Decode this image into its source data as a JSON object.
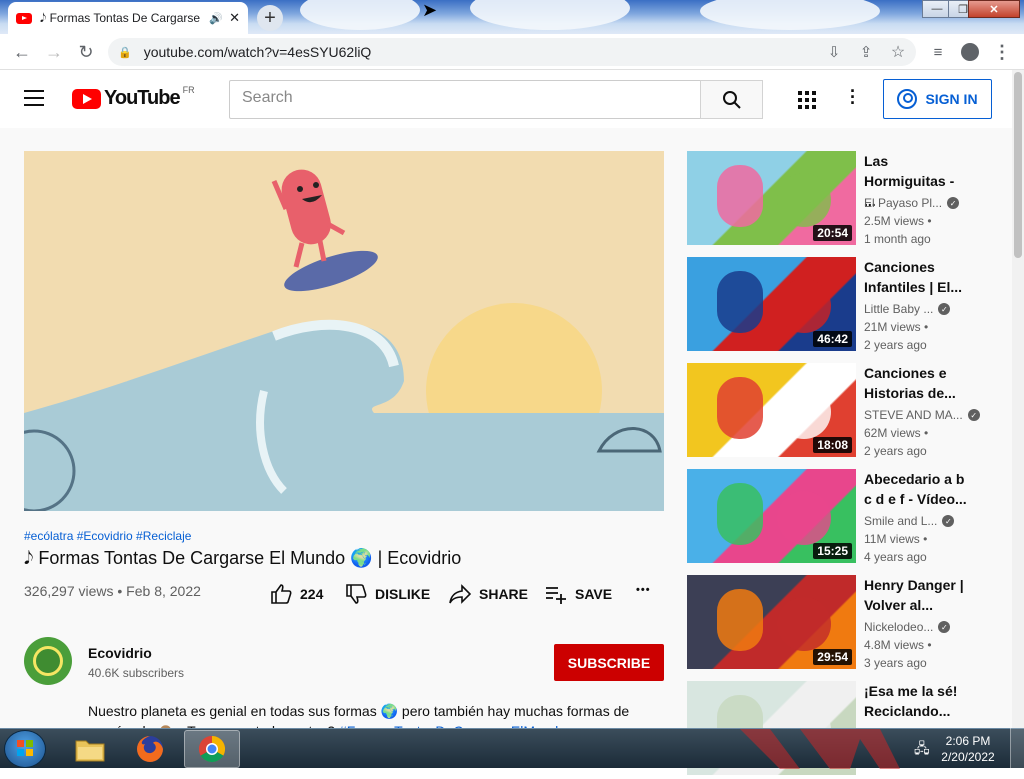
{
  "browser": {
    "tab_title": "𝅘𝅥𝅮 Formas Tontas De Cargarse El Mundo",
    "tab_close": "✕",
    "new_tab": "+",
    "url": "youtube.com/watch?v=4esSYU62liQ",
    "window_buttons": {
      "minimize": "—",
      "restore": "❐",
      "close": "✕"
    }
  },
  "youtube": {
    "logo_text": "YouTube",
    "region": "FR",
    "search_placeholder": "Search",
    "sign_in": "SIGN IN"
  },
  "video": {
    "hashtags": "#ecólatra #Ecovidrio #Reciclaje",
    "title": "𝅘𝅥𝅮 Formas Tontas De Cargarse El Mundo 🌍 | Ecovidrio",
    "views_date": "326,297 views • Feb 8, 2022",
    "likes": "224",
    "dislike": "DISLIKE",
    "share": "SHARE",
    "save": "SAVE",
    "more": "•••"
  },
  "channel": {
    "name": "Ecovidrio",
    "subscribers": "40.6K subscribers",
    "subscribe": "SUBSCRIBE"
  },
  "description": {
    "line1": "Nuestro planeta es genial en todas sus formas 🌍 pero también hay muchas formas de",
    "line2_text": "cargárselo 🙈 ¿Te suenan todas estas? ",
    "line2_link": "#FormasTontasDeCargarseElMundo"
  },
  "recommendations": [
    {
      "title1": "Las",
      "title2": "Hormiguitas - ...",
      "channel": "El Payaso Pl...",
      "views": "2.5M views •",
      "age": "1 month ago",
      "duration": "20:54",
      "colors": [
        "#8fd0e6",
        "#7fbf4a",
        "#f06aa0"
      ]
    },
    {
      "title1": "Canciones",
      "title2": "Infantiles | El...",
      "channel": "Little Baby ...",
      "views": "21M views •",
      "age": "2 years ago",
      "duration": "46:42",
      "colors": [
        "#3aa0e0",
        "#d02020",
        "#1a3c8c"
      ]
    },
    {
      "title1": "Canciones e",
      "title2": "Historias de...",
      "channel": "STEVE AND MA...",
      "views": "62M views •",
      "age": "2 years ago",
      "duration": "18:08",
      "colors": [
        "#f2c61f",
        "#ffffff",
        "#e04030"
      ]
    },
    {
      "title1": "Abecedario a b",
      "title2": "c d e f - Vídeo...",
      "channel": "Smile and L...",
      "views": "11M views •",
      "age": "4 years ago",
      "duration": "15:25",
      "colors": [
        "#4ab0e8",
        "#e8468c",
        "#38c060"
      ]
    },
    {
      "title1": "Henry Danger |",
      "title2": "Volver al...",
      "channel": "Nickelodeo...",
      "views": "4.8M views •",
      "age": "3 years ago",
      "duration": "29:54",
      "colors": [
        "#3c3f55",
        "#c02a2a",
        "#f07a10"
      ]
    },
    {
      "title1": "¡Esa me la sé!",
      "title2": "Reciclando...",
      "channel": "",
      "views": "",
      "age": "",
      "duration": "",
      "colors": [
        "#d8e6e0",
        "#f0f0f0",
        "#c8d8c0"
      ]
    }
  ],
  "taskbar": {
    "time": "2:06 PM",
    "date": "2/20/2022"
  }
}
